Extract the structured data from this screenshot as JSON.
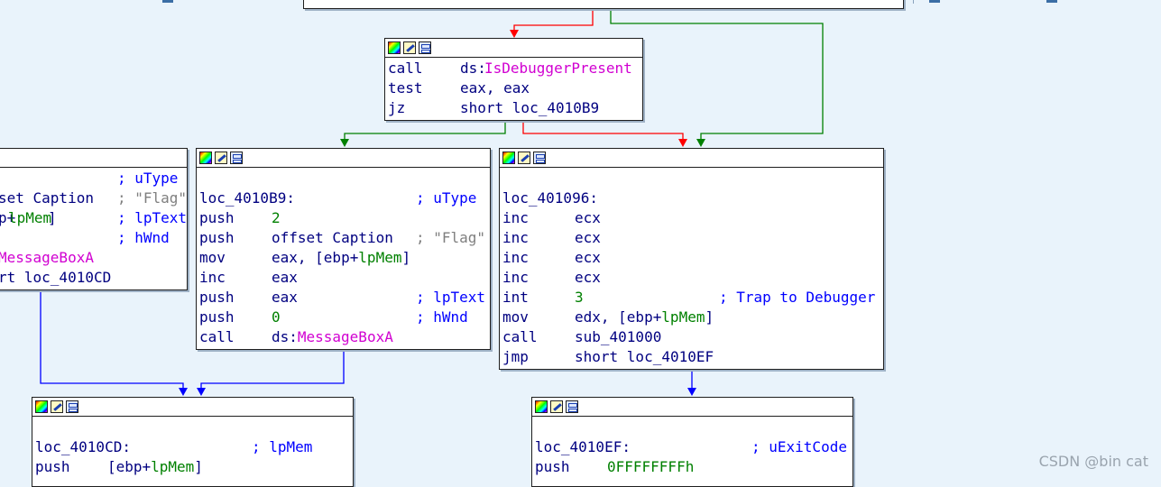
{
  "colors": {
    "background": "#e9f3fb",
    "edge_true": "#008000",
    "edge_false": "#ff0000",
    "edge_uncond": "#0000ff"
  },
  "watermark": "CSDN @bin cat",
  "blocks": [
    {
      "id": "top-partial",
      "lines": []
    },
    {
      "id": "check",
      "lines": [
        [
          {
            "t": "call",
            "c": "mn"
          },
          {
            "t": "ds:",
            "c": "op"
          },
          {
            "t": "IsDebuggerPresent",
            "c": "sym"
          }
        ],
        [
          {
            "t": "test",
            "c": "mn"
          },
          {
            "t": "eax, eax",
            "c": "op"
          }
        ],
        [
          {
            "t": "jz",
            "c": "mn"
          },
          {
            "t": "short loc_4010B9",
            "c": "op"
          }
        ]
      ]
    },
    {
      "id": "left-partial",
      "lines": [
        [
          {
            "t": "; uType",
            "c": "cmt"
          }
        ],
        [
          {
            "t": "set Caption",
            "c": "op"
          },
          {
            "t": "; \"Flag\"",
            "c": "str"
          }
        ],
        [
          {
            "t": "p+",
            "c": "op"
          },
          {
            "t": "lpMem",
            "c": "var"
          },
          {
            "t": "]",
            "c": "op"
          },
          {
            "t": "; lpText",
            "c": "cmt"
          }
        ],
        [
          {
            "t": "; hWnd",
            "c": "cmt"
          }
        ],
        [
          {
            "t": "MessageBoxA",
            "c": "sym"
          }
        ],
        [
          {
            "t": "rt loc_4010CD",
            "c": "op"
          }
        ]
      ]
    },
    {
      "id": "loc_4010B9",
      "lines": [
        [],
        [
          {
            "t": "loc_4010B9:",
            "c": "lbl"
          },
          {
            "t": "; uType",
            "c": "cmt"
          }
        ],
        [
          {
            "t": "push",
            "c": "mn"
          },
          {
            "t": "2",
            "c": "num"
          }
        ],
        [
          {
            "t": "push",
            "c": "mn"
          },
          {
            "t": "offset Caption",
            "c": "op"
          },
          {
            "t": "; \"Flag\"",
            "c": "str"
          }
        ],
        [
          {
            "t": "mov",
            "c": "mn"
          },
          {
            "t": "eax, [ebp+",
            "c": "op"
          },
          {
            "t": "lpMem",
            "c": "var"
          },
          {
            "t": "]",
            "c": "op"
          }
        ],
        [
          {
            "t": "inc",
            "c": "mn"
          },
          {
            "t": "eax",
            "c": "op"
          }
        ],
        [
          {
            "t": "push",
            "c": "mn"
          },
          {
            "t": "eax",
            "c": "op"
          },
          {
            "t": "; lpText",
            "c": "cmt"
          }
        ],
        [
          {
            "t": "push",
            "c": "mn"
          },
          {
            "t": "0",
            "c": "num"
          },
          {
            "t": "; hWnd",
            "c": "cmt"
          }
        ],
        [
          {
            "t": "call",
            "c": "mn"
          },
          {
            "t": "ds:",
            "c": "op"
          },
          {
            "t": "MessageBoxA",
            "c": "sym"
          }
        ]
      ]
    },
    {
      "id": "loc_401096",
      "lines": [
        [],
        [
          {
            "t": "loc_401096:",
            "c": "lbl"
          }
        ],
        [
          {
            "t": "inc",
            "c": "mn"
          },
          {
            "t": "ecx",
            "c": "op"
          }
        ],
        [
          {
            "t": "inc",
            "c": "mn"
          },
          {
            "t": "ecx",
            "c": "op"
          }
        ],
        [
          {
            "t": "inc",
            "c": "mn"
          },
          {
            "t": "ecx",
            "c": "op"
          }
        ],
        [
          {
            "t": "inc",
            "c": "mn"
          },
          {
            "t": "ecx",
            "c": "op"
          }
        ],
        [
          {
            "t": "int",
            "c": "mn"
          },
          {
            "t": "3",
            "c": "num"
          },
          {
            "t": "; Trap to Debugger",
            "c": "cmt"
          }
        ],
        [
          {
            "t": "mov",
            "c": "mn"
          },
          {
            "t": "edx, [ebp+",
            "c": "op"
          },
          {
            "t": "lpMem",
            "c": "var"
          },
          {
            "t": "]",
            "c": "op"
          }
        ],
        [
          {
            "t": "call",
            "c": "mn"
          },
          {
            "t": "sub_401000",
            "c": "op"
          }
        ],
        [
          {
            "t": "jmp",
            "c": "mn"
          },
          {
            "t": "short loc_4010EF",
            "c": "op"
          }
        ]
      ]
    },
    {
      "id": "loc_4010CD",
      "lines": [
        [],
        [
          {
            "t": "loc_4010CD:",
            "c": "lbl"
          },
          {
            "t": "; lpMem",
            "c": "cmt"
          }
        ],
        [
          {
            "t": "push",
            "c": "mn"
          },
          {
            "t": "[ebp+",
            "c": "op"
          },
          {
            "t": "lpMem",
            "c": "var"
          },
          {
            "t": "]",
            "c": "op"
          }
        ]
      ]
    },
    {
      "id": "loc_4010EF",
      "lines": [
        [],
        [
          {
            "t": "loc_4010EF:",
            "c": "lbl"
          },
          {
            "t": "; uExitCode",
            "c": "cmt"
          }
        ],
        [
          {
            "t": "push",
            "c": "mn"
          },
          {
            "t": "0FFFFFFFFh",
            "c": "num"
          }
        ]
      ]
    }
  ]
}
